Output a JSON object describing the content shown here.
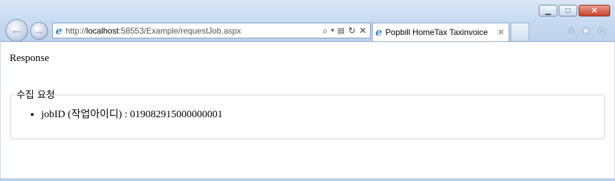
{
  "window": {
    "controls": {
      "minimize": "▁",
      "maximize": "□",
      "close": "✕"
    }
  },
  "nav": {
    "back_icon": "back-arrow-icon",
    "forward_icon": "forward-arrow-icon"
  },
  "address_bar": {
    "scheme": "http://",
    "host": "localhost",
    "rest": ":58553/Example/requestJob.aspx"
  },
  "tabs": [
    {
      "title": "Popbill HomeTax Taxinvoice",
      "close": "✕"
    }
  ],
  "page": {
    "heading": "Response",
    "fieldset_legend": "수집 요청",
    "items": [
      {
        "text": "jobID (작업아이디) : 019082915000000001"
      }
    ]
  }
}
